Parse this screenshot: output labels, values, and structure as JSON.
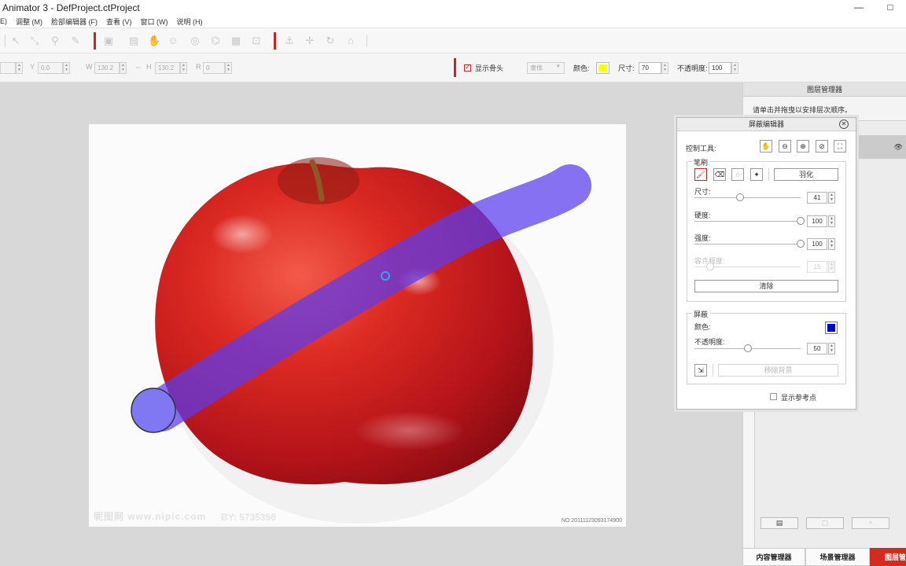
{
  "window": {
    "title": "Animator 3 - DefProject.ctProject",
    "controls": [
      "—",
      "□"
    ]
  },
  "menu": [
    "E)",
    "调整 (M)",
    "脸部编辑器 (F)",
    "查看 (V)",
    "窗口 (W)",
    "说明 (H)"
  ],
  "props": {
    "y_label": "Y",
    "y_value": "0.0",
    "w_label": "W",
    "w_value": "130.2",
    "h_label": "H",
    "h_value": "130.2",
    "r_label": "R",
    "r_value": "0",
    "show_bones_label": "显示骨头",
    "font_value": "隶体",
    "color_label": "颜色:",
    "color_value": "#ffff00",
    "size_label": "尺寸:",
    "size_value": "70",
    "opacity_label": "不透明度:",
    "opacity_value": "100"
  },
  "canvas": {
    "watermark": "昵图网 www.nipic.com",
    "watermark_by": "BY: 5735356",
    "serial": "NO:20111123093174900"
  },
  "layer_panel": {
    "title": "图层管理器",
    "hint": "请单击并拖曳以安排层次顺序。",
    "eye_icon": "eye-icon"
  },
  "bottom_tabs": [
    "内容管理器",
    "场景管理器",
    "图层管理器"
  ],
  "mask_editor": {
    "title": "屏蔽编辑器",
    "control_tools_label": "控制工具:",
    "brush_group": "笔刷",
    "feather_label": "羽化",
    "size_label": "尺寸:",
    "size_value": "41",
    "size_level": 0.43,
    "hardness_label": "硬度:",
    "hardness_value": "100",
    "hardness_level": 1.0,
    "strength_label": "强度:",
    "strength_value": "100",
    "strength_level": 1.0,
    "tolerance_label": "容许程度:",
    "tolerance_value": "15",
    "tolerance_level": 0.15,
    "clear_label": "清除",
    "mask_group": "屏蔽",
    "mask_color_label": "颜色:",
    "mask_color": "#0000cc",
    "mask_opacity_label": "不透明度:",
    "mask_opacity_value": "50",
    "mask_opacity_level": 0.5,
    "remove_bg_label": "移除背景",
    "show_ref_label": "显示参考点"
  },
  "colors": {
    "accent": "#c8261e",
    "stroke": "#6a5cff"
  }
}
